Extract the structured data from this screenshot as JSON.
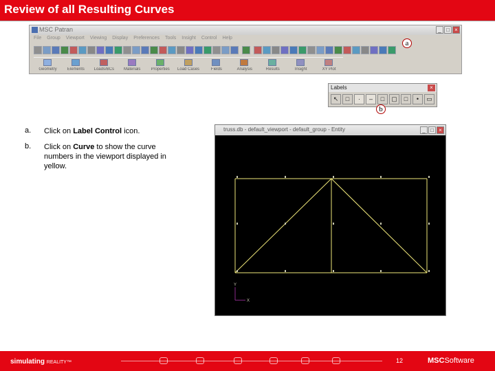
{
  "slide": {
    "title": "Review of all Resulting Curves",
    "page_number": "12"
  },
  "patran": {
    "window_title": "MSC Patran",
    "menus": [
      "File",
      "Group",
      "Viewport",
      "Viewing",
      "Display",
      "Preferences",
      "Tools",
      "Insight",
      "Control",
      "Help"
    ],
    "applications": [
      "Geometry",
      "Elements",
      "Loads/BCs",
      "Materials",
      "Properties",
      "Load Cases",
      "Fields",
      "Analysis",
      "Results",
      "Insight",
      "XY Plot"
    ]
  },
  "callouts": {
    "a": "a",
    "b": "b"
  },
  "labels_toolbar": {
    "title": "Labels",
    "close": "×",
    "buttons": [
      "↖",
      "□",
      "·",
      "–",
      "□",
      "▢",
      "□",
      "•",
      "▭"
    ]
  },
  "instructions": [
    {
      "letter": "a.",
      "parts": [
        "Click on ",
        "Label Control",
        " icon."
      ]
    },
    {
      "letter": "b.",
      "parts": [
        "Click on ",
        "Curve",
        " to show the curve numbers in the viewport displayed in yellow."
      ]
    }
  ],
  "viewport": {
    "title": "truss.db - default_viewport - default_group - Entity",
    "axis_y": "Y",
    "axis_x": "X"
  },
  "footer": {
    "brand": "simulating",
    "brand_reality": "REALITY™",
    "company": "MSC",
    "company_suffix": "Software"
  },
  "colors": {
    "accent": "#e30613",
    "curve": "#f0e87a",
    "node": "#c8c8b0"
  }
}
